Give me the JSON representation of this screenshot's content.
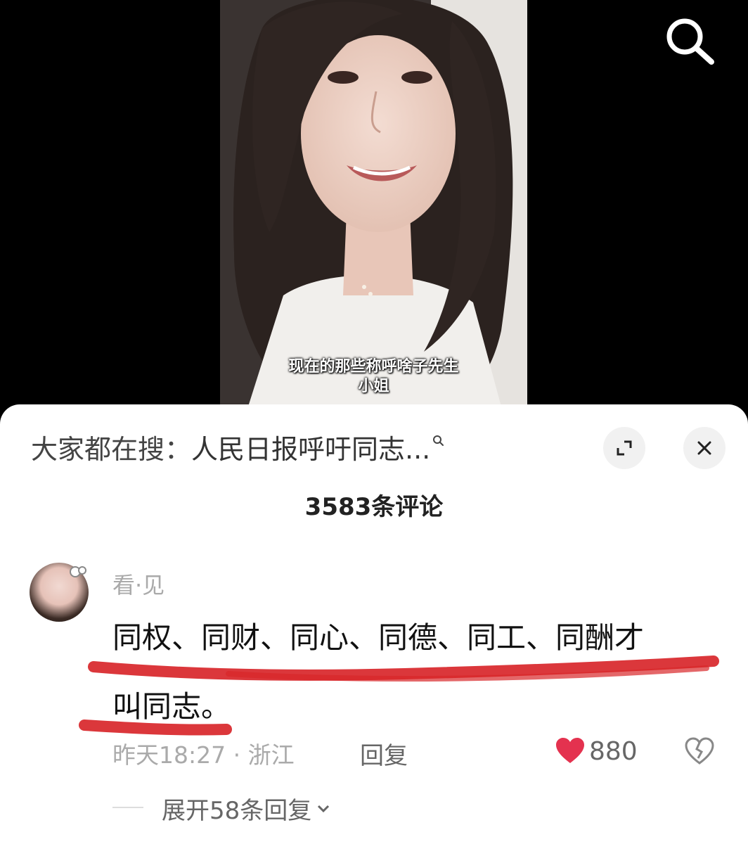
{
  "video": {
    "subtitle_line1": "现在的那些称呼啥子先生",
    "subtitle_line2": "小姐"
  },
  "icons": {
    "search": "search-icon",
    "expand": "expand-icon",
    "close": "close-icon",
    "like": "heart-icon",
    "dislike": "broken-heart-icon",
    "chevron": "chevron-down-icon"
  },
  "trending": {
    "prefix": "大家都在搜：",
    "query": "人民日报呼吁同志..."
  },
  "comments_header": {
    "count_label": "3583条评论"
  },
  "comment": {
    "username": "看·见",
    "text_line1": "同权、同财、同心、同德、同工、同酬才",
    "text_line2": "叫同志。",
    "timestamp": "昨天18:27",
    "location": "浙江",
    "meta": "昨天18:27 · 浙江",
    "reply_label": "回复",
    "like_count": "880",
    "expand_replies_label": "展开58条回复"
  },
  "colors": {
    "like": "#e4324f",
    "underline": "#d8262a",
    "text_primary": "#111111",
    "text_secondary": "#aaaaaa"
  }
}
